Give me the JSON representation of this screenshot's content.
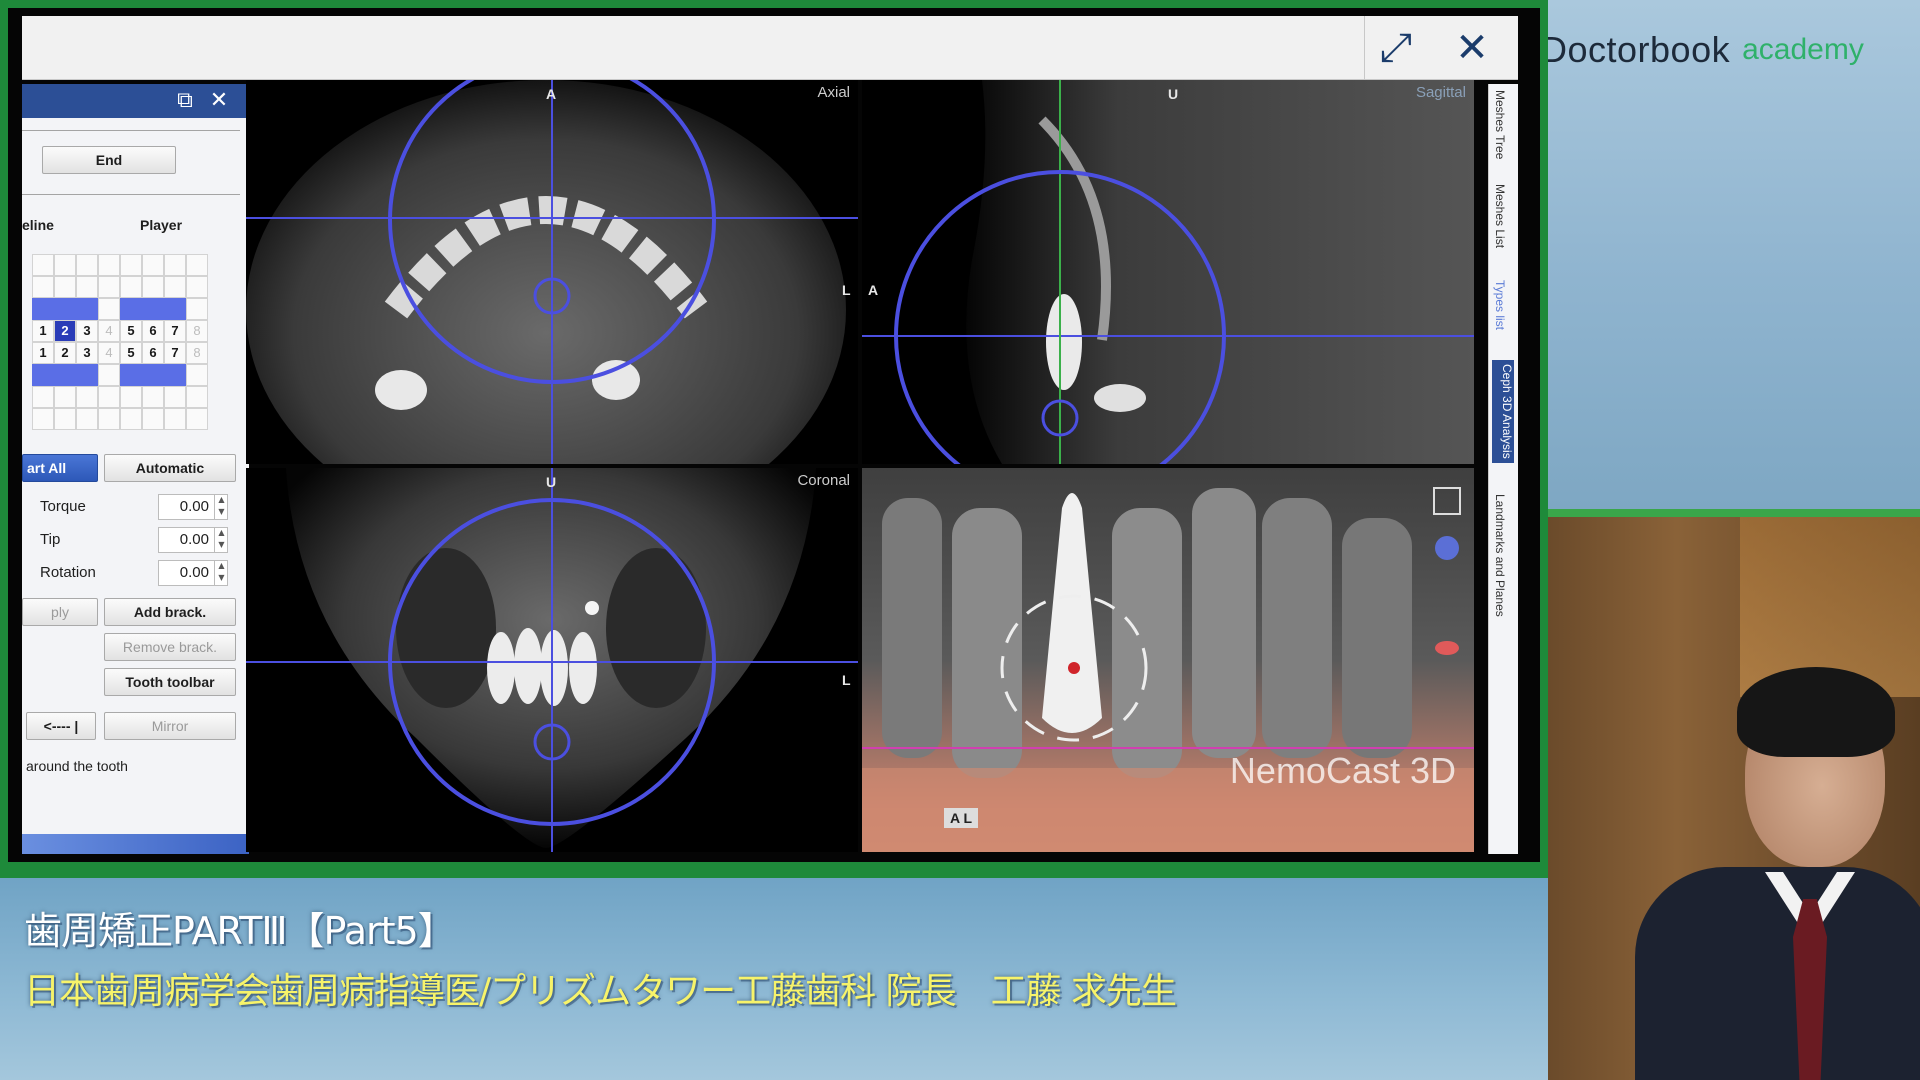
{
  "brand": {
    "name": "Doctorbook",
    "suffix": "academy"
  },
  "window": {
    "expand_icon": "expand-arrows-icon",
    "close_icon": "close-icon"
  },
  "panel": {
    "end_button": "End",
    "tab_timeline": "eline",
    "tab_player": "Player",
    "grid_row1": [
      "1",
      "2",
      "3",
      "4",
      "5",
      "6",
      "7",
      "8"
    ],
    "grid_row2": [
      "1",
      "2",
      "3",
      "4",
      "5",
      "6",
      "7",
      "8"
    ],
    "selected_tooth": "2",
    "start_all": "art All",
    "automatic": "Automatic",
    "torque_label": "Torque",
    "torque_value": "0.00",
    "tip_label": "Tip",
    "tip_value": "0.00",
    "rotation_label": "Rotation",
    "rotation_value": "0.00",
    "apply_button": "ply",
    "add_bracket": "Add brack.",
    "remove_bracket": "Remove brack.",
    "tooth_toolbar": "Tooth toolbar",
    "arrow_button": "<---- |",
    "mirror_button": "Mirror",
    "hint": "around the tooth"
  },
  "viewports": {
    "axial": {
      "label": "Axial",
      "top": "A",
      "right": "L"
    },
    "sagittal": {
      "label": "Sagittal",
      "top": "U",
      "left": "A"
    },
    "coronal": {
      "label": "Coronal",
      "top": "U",
      "right": "L"
    },
    "model3d": {
      "watermark": "NemoCast 3D",
      "corner_letter": "A L"
    }
  },
  "side_tabs": [
    "Meshes Tree",
    "Meshes List",
    "Types list",
    "Ceph 3D Analysis",
    "Landmarks and Planes"
  ],
  "caption": {
    "title": "歯周矯正PARTⅢ【Part5】",
    "subtitle": "日本歯周病学会歯周病指導医/プリズムタワー工藤歯科 院長　工藤 求先生"
  },
  "colors": {
    "frame_green": "#1e8a3a",
    "caption_yellow": "#f7f36a",
    "circle_blue": "#4b4fe0",
    "panel_header_blue": "#2c4f96"
  }
}
